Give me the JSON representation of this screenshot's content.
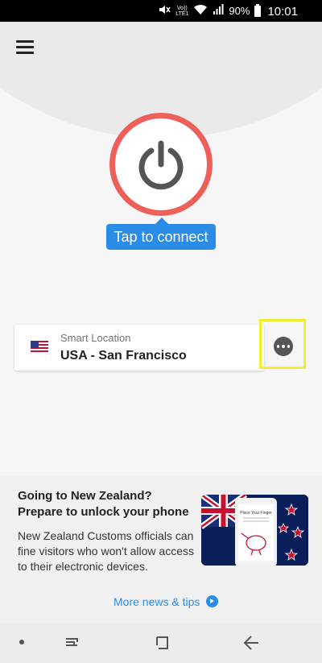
{
  "status_bar": {
    "volte_label": "Vo))",
    "lte_label": "LTE1",
    "battery_percent": "90%",
    "time": "10:01"
  },
  "header": {
    "menu_icon": "hamburger-menu-icon"
  },
  "power": {
    "icon": "power-icon",
    "ring_color": "#ee5f59",
    "connect_label": "Tap to connect"
  },
  "location": {
    "flag": "usa-flag-icon",
    "sub_label": "Smart Location",
    "name": "USA - San Francisco",
    "more_icon": "more-options-icon",
    "highlight_color": "#f7ec2a"
  },
  "news": {
    "title": "Going to New Zealand? Prepare to unlock your phone",
    "body": "New Zealand Customs officials can fine visitors who won't allow access to their electronic devices.",
    "image_text": "Place Your Finger",
    "more_link": "More news & tips",
    "accent_color": "#2a8ce6"
  },
  "nav": {
    "items": [
      "dot-icon",
      "recents-icon",
      "home-icon",
      "back-icon"
    ]
  }
}
